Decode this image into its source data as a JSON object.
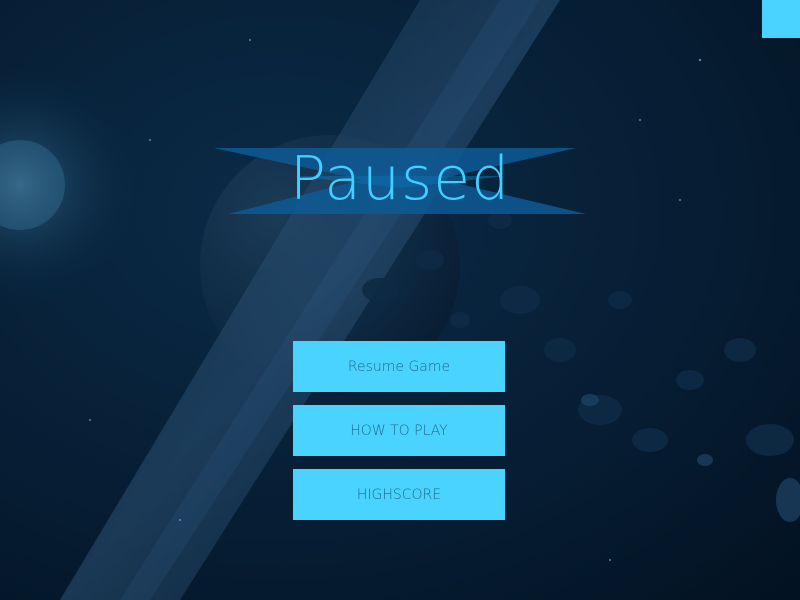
{
  "game": {
    "title": "Paused",
    "menu": [
      {
        "id": "resume",
        "label": "Resume Game"
      },
      {
        "id": "how-to-play",
        "label": "HOW TO PLAY"
      },
      {
        "id": "highscore",
        "label": "HIGHSCORE"
      }
    ]
  },
  "colors": {
    "background": "#061a2e",
    "button": "#4ad3ff",
    "button_text": "#1b6c8f",
    "title": "#40cfff",
    "banner": "#0d5b95"
  },
  "icons": {
    "corner": "square-icon"
  }
}
